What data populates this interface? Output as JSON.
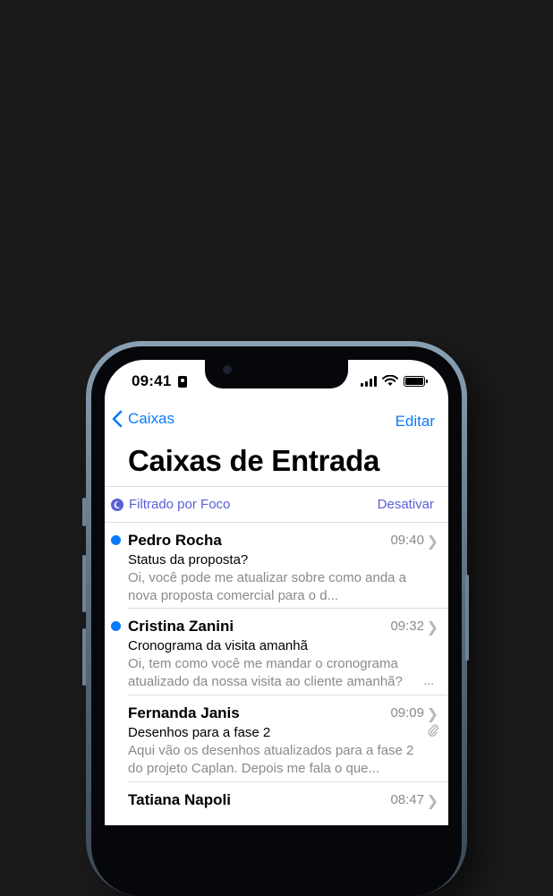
{
  "status_bar": {
    "time": "09:41"
  },
  "nav": {
    "back_label": "Caixas",
    "edit_label": "Editar"
  },
  "page": {
    "title": "Caixas de Entrada"
  },
  "focus_filter": {
    "label": "Filtrado por Foco",
    "action": "Desativar"
  },
  "mails": [
    {
      "sender": "Pedro Rocha",
      "time": "09:40",
      "subject": "Status da proposta?",
      "preview": "Oi, você pode me atualizar sobre como anda a nova proposta comercial para o d...",
      "unread": true
    },
    {
      "sender": "Cristina Zanini",
      "time": "09:32",
      "subject": "Cronograma da visita amanhã",
      "preview": "Oi, tem como você me mandar o cronograma atualizado da nossa visita ao cliente amanhã?",
      "more": "...",
      "unread": true
    },
    {
      "sender": "Fernanda Janis",
      "time": "09:09",
      "subject": "Desenhos para a fase 2",
      "preview": "Aqui vão os desenhos atualizados para a fase 2 do projeto Caplan. Depois me fala o que...",
      "unread": false,
      "attachment": true
    },
    {
      "sender": "Tatiana Napoli",
      "time": "08:47",
      "unread": false
    }
  ],
  "colors": {
    "accent": "#0a7aff",
    "focus": "#5b5fd6",
    "background": "#1b1b1c"
  },
  "icons": [
    "contact-card-icon",
    "signal-icon",
    "wifi-icon",
    "battery-icon",
    "chevron-left-icon",
    "moon-icon",
    "chevron-right-icon",
    "paperclip-icon"
  ]
}
